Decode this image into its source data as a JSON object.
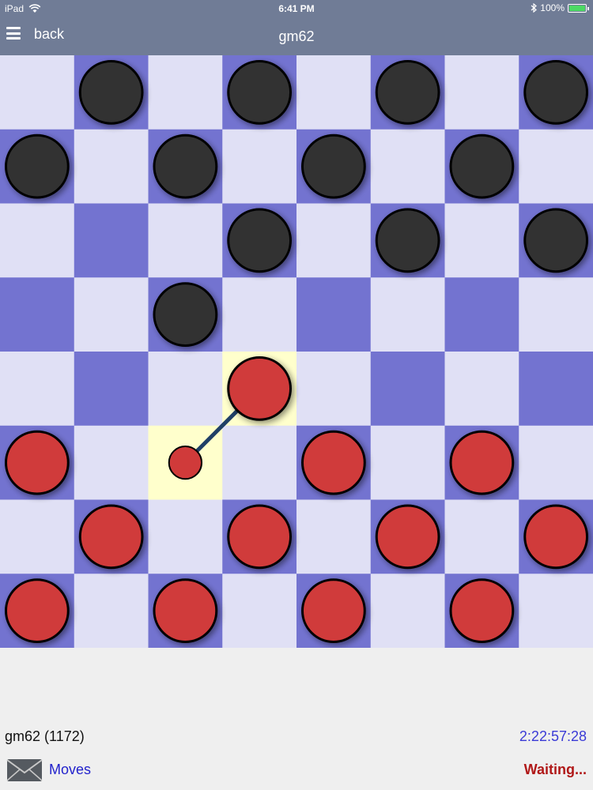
{
  "status_bar": {
    "device": "iPad",
    "time": "6:41 PM",
    "battery": "100%",
    "battery_level": 1.0
  },
  "nav": {
    "back_label": "back",
    "title": "gm62"
  },
  "board": {
    "light_color": "#e0e0f5",
    "dark_color": "#7373d0",
    "highlight_color": "#ffffcc",
    "black_piece_color": "#333333",
    "red_piece_color": "#d03a3a",
    "move_line_color": "#1f3f66",
    "black_pieces": [
      [
        0,
        1
      ],
      [
        0,
        3
      ],
      [
        0,
        5
      ],
      [
        0,
        7
      ],
      [
        1,
        0
      ],
      [
        1,
        2
      ],
      [
        1,
        4
      ],
      [
        1,
        6
      ],
      [
        2,
        3
      ],
      [
        2,
        5
      ],
      [
        2,
        7
      ],
      [
        3,
        2
      ]
    ],
    "red_pieces": [
      [
        4,
        3
      ],
      [
        5,
        0
      ],
      [
        5,
        4
      ],
      [
        5,
        6
      ],
      [
        6,
        1
      ],
      [
        6,
        3
      ],
      [
        6,
        5
      ],
      [
        6,
        7
      ],
      [
        7,
        0
      ],
      [
        7,
        2
      ],
      [
        7,
        4
      ],
      [
        7,
        6
      ]
    ],
    "last_move": {
      "from": [
        5,
        2
      ],
      "to": [
        4,
        3
      ]
    },
    "highlighted_squares": [
      [
        4,
        3
      ],
      [
        5,
        2
      ]
    ]
  },
  "footer": {
    "player": "gm62 (1172)",
    "timer": "2:22:57:28",
    "moves_label": "Moves",
    "status": "Waiting..."
  }
}
